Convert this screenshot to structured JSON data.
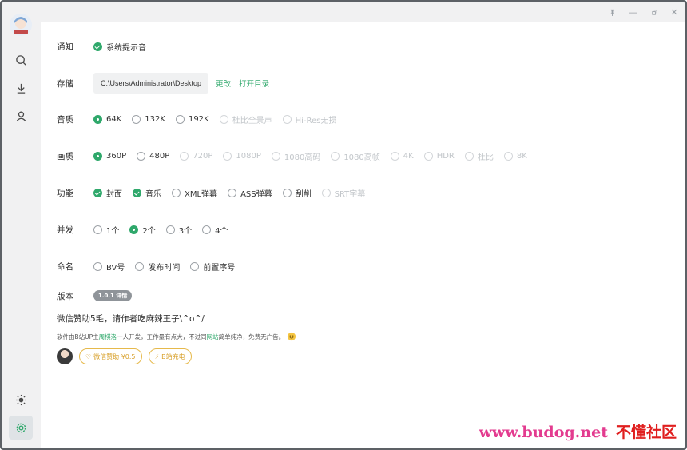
{
  "window": {
    "controls": [
      "pin-icon",
      "minimize-icon",
      "restore-icon",
      "close-icon"
    ]
  },
  "sidebar": {
    "items": [
      {
        "name": "search",
        "icon": "search-icon"
      },
      {
        "name": "download",
        "icon": "download-icon"
      },
      {
        "name": "user",
        "icon": "user-icon"
      },
      {
        "name": "theme",
        "icon": "sun-icon"
      },
      {
        "name": "settings",
        "icon": "gear-icon",
        "active": true
      }
    ]
  },
  "settings": {
    "notify": {
      "label": "通知",
      "option": "系统提示音"
    },
    "storage": {
      "label": "存储",
      "path": "C:\\Users\\Administrator\\Desktop",
      "change": "更改",
      "open_dir": "打开目录"
    },
    "audio": {
      "label": "音质",
      "options": [
        "64K",
        "132K",
        "192K",
        "杜比全景声",
        "Hi-Res无损"
      ],
      "selected": "64K"
    },
    "video": {
      "label": "画质",
      "options": [
        "360P",
        "480P",
        "720P",
        "1080P",
        "1080高码",
        "1080高帧",
        "4K",
        "HDR",
        "杜比",
        "8K"
      ],
      "selected": "360P"
    },
    "features": {
      "label": "功能",
      "options": [
        "封面",
        "音乐",
        "XML弹幕",
        "ASS弹幕",
        "刮削",
        "SRT字幕"
      ],
      "checked": [
        "封面",
        "音乐"
      ]
    },
    "concurrency": {
      "label": "并发",
      "options": [
        "1个",
        "2个",
        "3个",
        "4个"
      ],
      "selected": "2个"
    },
    "naming": {
      "label": "命名",
      "options": [
        "BV号",
        "发布时间",
        "前置序号"
      ]
    },
    "version": {
      "label": "版本",
      "badge": "1.0.1 详情"
    }
  },
  "donate": {
    "title": "微信赞助5毛，请作者吃麻辣王子\\^o^/",
    "credit_prefix": "软件由B站UP主 ",
    "author": "周棋洛",
    "credit_mid": " 一人开发，工作量有点大，不过同 ",
    "site": "网站",
    "credit_suffix": " 简单纯净，免费无广告。",
    "wechat_button": "微信赞助 ¥0.5",
    "bili_button": "B站充电"
  },
  "watermark": {
    "latin": "www.budog.net",
    "cn": "不懂社区"
  },
  "colors": {
    "accent": "#2fa86b",
    "gold": "#d8a02a",
    "watermark": "#e33b8f"
  }
}
